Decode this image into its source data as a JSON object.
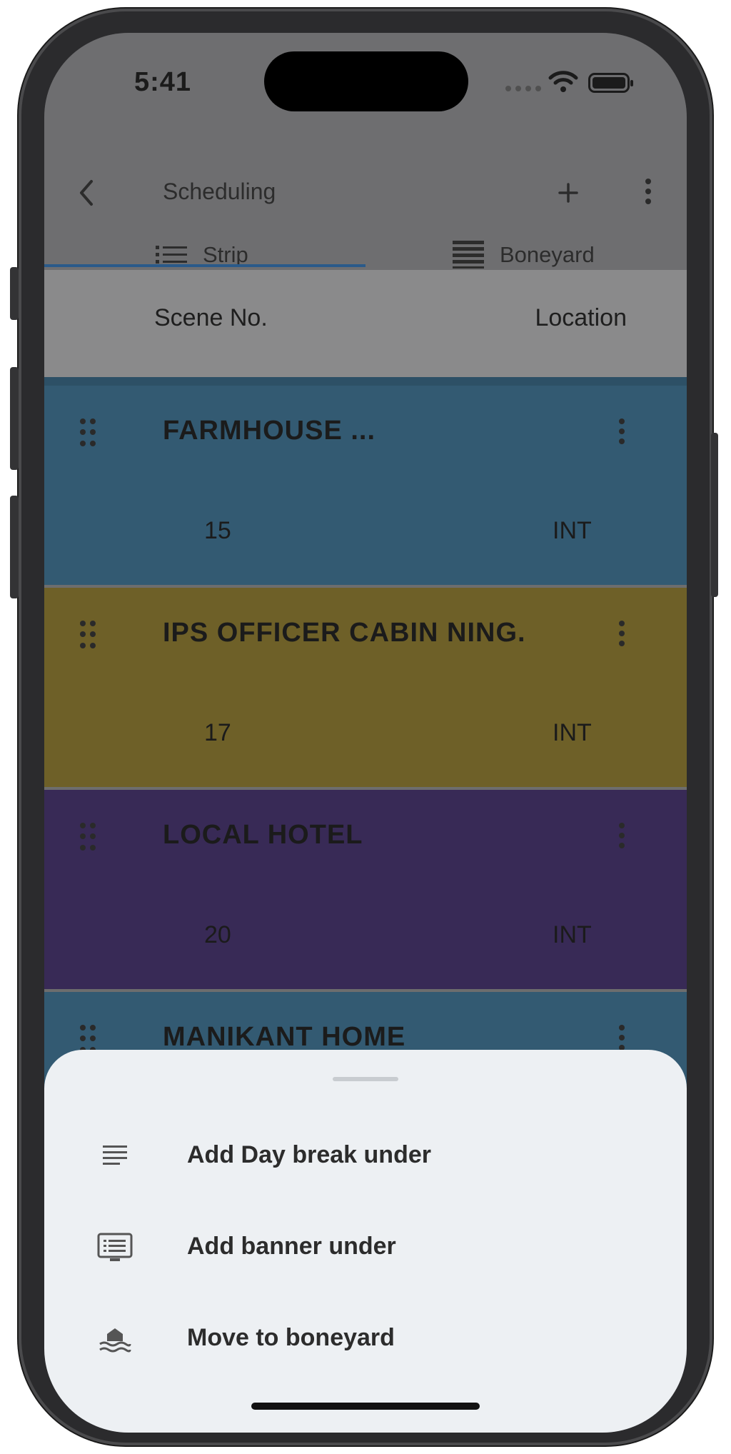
{
  "status_bar": {
    "time": "5:41"
  },
  "appbar": {
    "title": "Scheduling",
    "tabs": [
      {
        "label": "Strip",
        "icon": "list-icon",
        "active": true
      },
      {
        "label": "Boneyard",
        "icon": "stacked-lines-icon",
        "active": false
      }
    ]
  },
  "columns": {
    "scene_no": "Scene No.",
    "location": "Location"
  },
  "strips": [
    {
      "name": "FARMHOUSE  ...",
      "scene": "15",
      "int_ext": "INT",
      "color": "#335a72"
    },
    {
      "name": "IPS OFFICER CABIN  NING.",
      "scene": "17",
      "int_ext": "INT",
      "color": "#6e6028"
    },
    {
      "name": "LOCAL HOTEL",
      "scene": "20",
      "int_ext": "INT",
      "color": "#382a56"
    },
    {
      "name": "MANIKANT HOME",
      "scene": "",
      "int_ext": "",
      "color": "#335a72"
    }
  ],
  "sheet": {
    "items": [
      {
        "label": "Add Day break under",
        "icon": "lines-icon"
      },
      {
        "label": "Add banner under",
        "icon": "banner-icon"
      },
      {
        "label": "Move to boneyard",
        "icon": "boneyard-icon"
      }
    ]
  }
}
